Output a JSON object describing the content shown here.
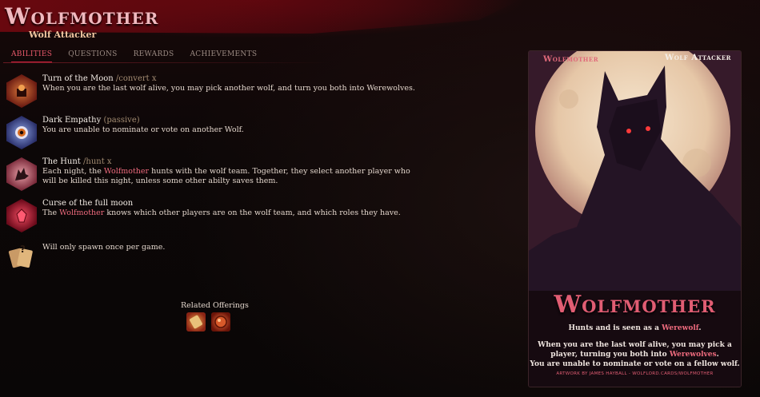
{
  "header": {
    "title": "Wolfmother",
    "subtitle": "Wolf Attacker"
  },
  "tabs": [
    {
      "label": "Abilities",
      "active": true
    },
    {
      "label": "Questions",
      "active": false
    },
    {
      "label": "Rewards",
      "active": false
    },
    {
      "label": "Achievements",
      "active": false
    }
  ],
  "abilities": [
    {
      "name": "Turn of the Moon",
      "command": "/convert x",
      "desc_parts": [
        "When you are the last wolf alive, you may pick another wolf, and turn you both into Werewolves."
      ],
      "icon": "moon-altar-icon",
      "color": "#8a2a1a"
    },
    {
      "name": "Dark Empathy",
      "command": "(passive)",
      "desc_parts": [
        "You are unable to nominate or vote on another Wolf."
      ],
      "icon": "eye-icon",
      "color": "#3a4a8a"
    },
    {
      "name": "The Hunt",
      "command": "/hunt x",
      "desc_parts": [
        "Each night, the ",
        "Wolfmother",
        " hunts with the wolf team. Together, they select another player who will be killed this night, unless some other abilty saves them."
      ],
      "icon": "wolf-head-icon",
      "color": "#b25a6a"
    },
    {
      "name": "Curse of the full moon",
      "command": "",
      "desc_parts": [
        "The ",
        "Wolfmother",
        " knows which other players are on the wolf team, and which roles they have."
      ],
      "icon": "crystal-icon",
      "color": "#b0203a"
    },
    {
      "name": "",
      "command": "",
      "desc_parts": [
        "Will only spawn once per game."
      ],
      "icon": "cards-question-icon",
      "color": "#c8a070"
    }
  ],
  "offerings": {
    "label": "Related Offerings",
    "items": [
      {
        "icon": "scroll-offering-icon",
        "color": "#c0402a"
      },
      {
        "icon": "orb-offering-icon",
        "color": "#b8301a"
      }
    ]
  },
  "card": {
    "name_top": "Wolfmother",
    "role_top": "Wolf Attacker",
    "big_name": "Wolfmother",
    "line1_parts": [
      "Hunts and is seen as a ",
      "Werewolf",
      "."
    ],
    "line2": "When you are the last wolf alive, you may pick a",
    "line3_parts": [
      "player, turning you both into ",
      "Werewolves",
      "."
    ],
    "line4": "You are unable to nominate or vote on a fellow wolf.",
    "credit": "ARTWORK BY JAMES HAYBALL - WOLFLORD.CARDS/WOLFMOTHER"
  }
}
